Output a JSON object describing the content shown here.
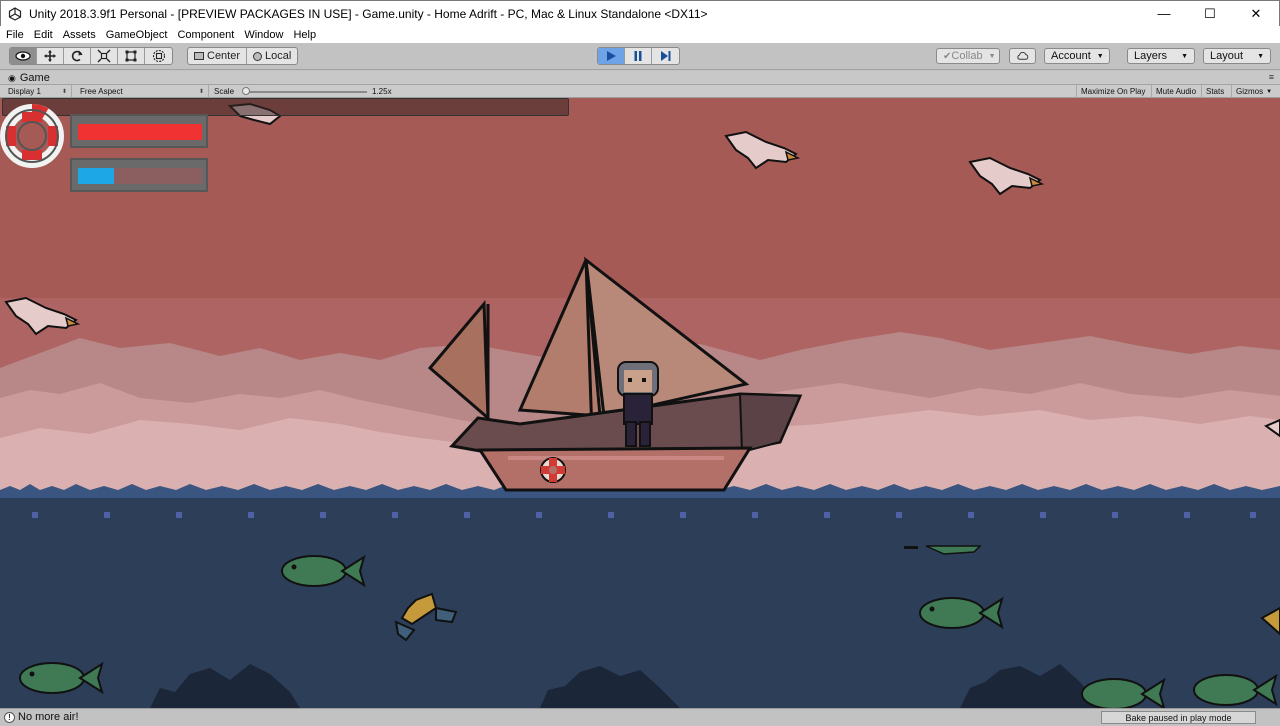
{
  "window": {
    "title": "Unity 2018.3.9f1 Personal - [PREVIEW PACKAGES IN USE] - Game.unity - Home Adrift - PC, Mac & Linux Standalone <DX11>",
    "app_icon": "unity-logo-icon",
    "controls": {
      "minimize": "—",
      "maximize": "☐",
      "close": "✕"
    }
  },
  "menu": {
    "items": [
      "File",
      "Edit",
      "Assets",
      "GameObject",
      "Component",
      "Window",
      "Help"
    ]
  },
  "toolbar": {
    "transform_tools": [
      "hand-eye-icon",
      "move-icon",
      "rotate-icon",
      "scale-icon",
      "rect-icon",
      "transform-all-icon"
    ],
    "pivot_center": "Center",
    "pivot_local": "Local",
    "play_controls": [
      "play-icon",
      "pause-icon",
      "step-icon"
    ],
    "collab": "Collab",
    "account": "Account",
    "layers": "Layers",
    "layout": "Layout"
  },
  "game_tab": {
    "label": "Game"
  },
  "game_bar": {
    "display": "Display 1",
    "aspect": "Free Aspect",
    "scale_label": "Scale",
    "scale_value": "1.25x",
    "scale_level": 0.02,
    "maximize_on_play": "Maximize On Play",
    "mute_audio": "Mute Audio",
    "stats": "Stats",
    "gizmos": "Gizmos"
  },
  "hud": {
    "health_fraction": 1.0,
    "air_fraction": 0.29,
    "health_color": "#f03232",
    "air_color": "#1ea7e6"
  },
  "status": {
    "message": "No more air!",
    "bake": "Bake paused in play mode"
  },
  "colors": {
    "sky": "#a55a56",
    "water": "#2c3e58",
    "accent_play": "#6fa3e7"
  }
}
